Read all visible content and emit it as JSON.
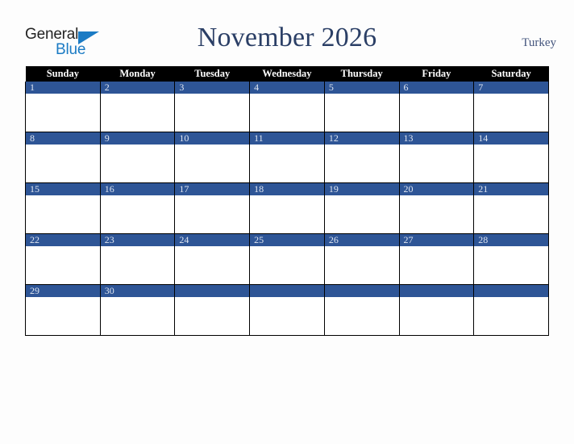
{
  "brand": {
    "word_one": "General",
    "word_two": "Blue",
    "triangle_icon": "triangle-icon",
    "color_dark": "#232323",
    "color_blue": "#1b7bc4"
  },
  "header": {
    "title": "November 2026",
    "month": "November",
    "year": "2026",
    "country": "Turkey",
    "title_color": "#2b3f66",
    "country_color": "#44557d"
  },
  "calendar": {
    "weekday_headers": [
      "Sunday",
      "Monday",
      "Tuesday",
      "Wednesday",
      "Thursday",
      "Friday",
      "Saturday"
    ],
    "header_bg": "#000000",
    "header_fg": "#ffffff",
    "daynum_bg": "#2e5596",
    "daynum_fg": "#dfe5f0",
    "cell_bg": "#ffffff",
    "grid_line": "#000000",
    "weeks": [
      {
        "days": [
          "1",
          "2",
          "3",
          "4",
          "5",
          "6",
          "7"
        ]
      },
      {
        "days": [
          "8",
          "9",
          "10",
          "11",
          "12",
          "13",
          "14"
        ]
      },
      {
        "days": [
          "15",
          "16",
          "17",
          "18",
          "19",
          "20",
          "21"
        ]
      },
      {
        "days": [
          "22",
          "23",
          "24",
          "25",
          "26",
          "27",
          "28"
        ]
      },
      {
        "days": [
          "29",
          "30",
          "",
          "",
          "",
          "",
          ""
        ]
      }
    ]
  },
  "page": {
    "background": "#fdfdfd"
  }
}
